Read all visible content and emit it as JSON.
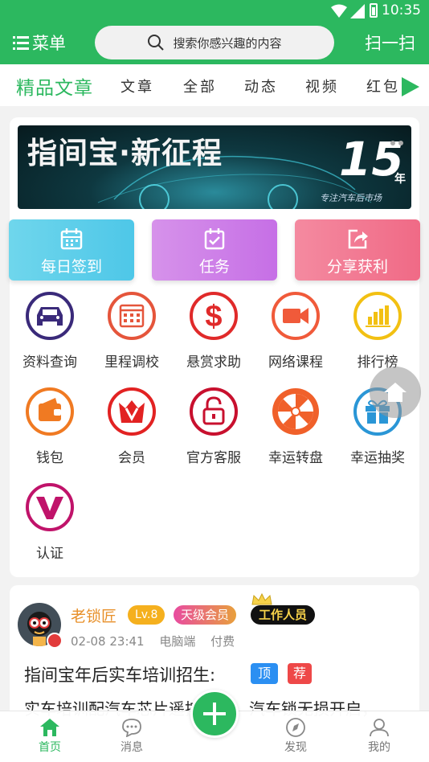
{
  "status": {
    "time": "10:35"
  },
  "header": {
    "menu_label": "菜单",
    "search_placeholder": "搜索你感兴趣的内容",
    "scan_label": "扫一扫"
  },
  "tabs": [
    "精品文章",
    "文章",
    "全部",
    "动态",
    "视频",
    "红包"
  ],
  "banner": {
    "title": "指间宝·新征程",
    "badge_number": "15",
    "badge_suffix": "年",
    "subtitle": "专注汽车后市场"
  },
  "actions": [
    {
      "label": "每日签到",
      "icon": "calendar-icon"
    },
    {
      "label": "任务",
      "icon": "clipboard-check-icon"
    },
    {
      "label": "分享获利",
      "icon": "share-icon"
    }
  ],
  "grid": [
    {
      "label": "资料查询",
      "icon": "car-icon",
      "color": "#3a2a7a"
    },
    {
      "label": "里程调校",
      "icon": "calendar-grid-icon",
      "color": "#e5553b"
    },
    {
      "label": "悬赏求助",
      "icon": "dollar-icon",
      "color": "#e02a2a"
    },
    {
      "label": "网络课程",
      "icon": "video-camera-icon",
      "color": "#f05a3a"
    },
    {
      "label": "排行榜",
      "icon": "bar-chart-icon",
      "color": "#f2c012"
    },
    {
      "label": "钱包",
      "icon": "wallet-icon",
      "color": "#f07a22"
    },
    {
      "label": "会员",
      "icon": "vip-crown-icon",
      "color": "#e22222"
    },
    {
      "label": "官方客服",
      "icon": "lock-icon",
      "color": "#c8102e"
    },
    {
      "label": "幸运转盘",
      "icon": "lucky-wheel-icon",
      "color": "#f0602a"
    },
    {
      "label": "幸运抽奖",
      "icon": "gift-icon",
      "color": "#2a96d6"
    },
    {
      "label": "认证",
      "icon": "verify-v-icon",
      "color": "#c0136a"
    }
  ],
  "post": {
    "author": "老锁匠",
    "level": "Lv.8",
    "vip": "天级会员",
    "role": "工作人员",
    "meta": [
      "02-08 23:41",
      "电脑端",
      "付费"
    ],
    "title": "指间宝年后实车培训招生:",
    "tag_top": "顶",
    "tag_recommend": "荐",
    "excerpt": "实车培训配汽车芯片遥控钥匙，汽车锁无损开启，"
  },
  "bottom_nav": [
    {
      "label": "首页",
      "icon": "home-icon"
    },
    {
      "label": "消息",
      "icon": "chat-icon"
    },
    {
      "label": "发现",
      "icon": "compass-icon"
    },
    {
      "label": "我的",
      "icon": "user-icon"
    }
  ],
  "colors": {
    "brand": "#2cb85f"
  }
}
